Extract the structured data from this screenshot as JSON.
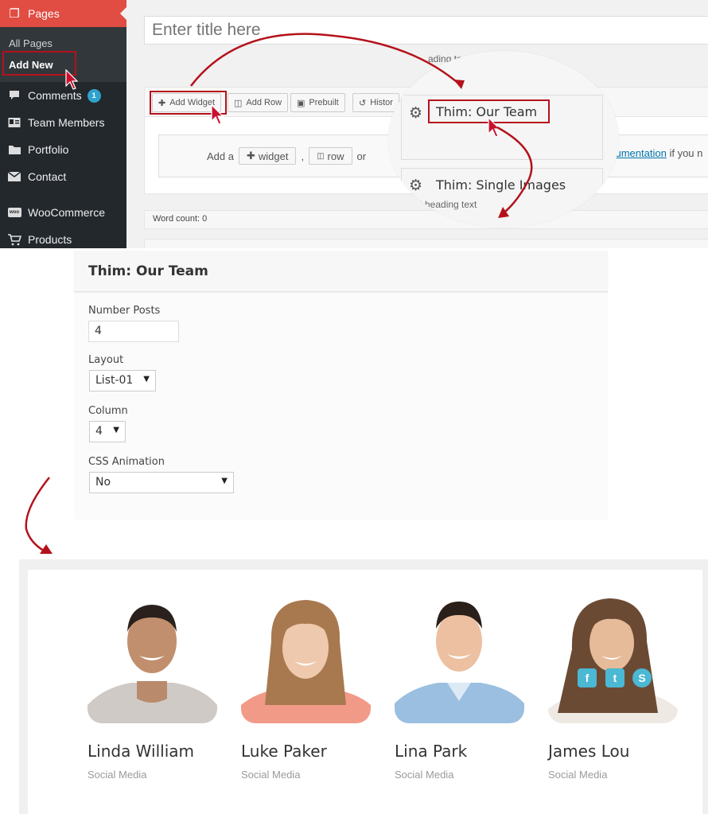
{
  "admin_menu": {
    "pages": "Pages",
    "all_pages": "All Pages",
    "add_new": "Add New",
    "comments": "Comments",
    "comments_count": "1",
    "team_members": "Team Members",
    "portfolio": "Portfolio",
    "contact": "Contact",
    "woocommerce": "WooCommerce",
    "woo_icon_text": "woo",
    "products": "Products"
  },
  "editor": {
    "title_placeholder": "Enter title here",
    "heading_text_fragment": "ading text",
    "toolbar": {
      "add_widget": "Add Widget",
      "add_row": "Add Row",
      "prebuilt": "Prebuilt",
      "history": "Histor"
    },
    "empty_state": {
      "prefix": "Add a",
      "widget": "widget",
      "comma": ",",
      "row": "row",
      "or": "or",
      "doc_link": "cumentation",
      "suffix": "if you n"
    },
    "word_count": "Word count: 0"
  },
  "zoom": {
    "widget_1": "Thim: Our Team",
    "widget_2": "Thim: Single Images",
    "heading_text_fragment": "d heading text"
  },
  "widget_form": {
    "title": "Thim: Our Team",
    "number_posts_label": "Number Posts",
    "number_posts_value": "4",
    "layout_label": "Layout",
    "layout_value": "List-01",
    "column_label": "Column",
    "column_value": "4",
    "css_animation_label": "CSS Animation",
    "css_animation_value": "No"
  },
  "team": [
    {
      "name": "Linda William",
      "role": "Social Media"
    },
    {
      "name": "Luke Paker",
      "role": "Social Media"
    },
    {
      "name": "Lina Park",
      "role": "Social Media"
    },
    {
      "name": "James Lou",
      "role": "Social Media"
    }
  ],
  "social_icons": [
    "facebook-icon",
    "twitter-icon",
    "skype-icon"
  ],
  "colors": {
    "accent_red": "#e14d43",
    "highlight_red": "#b4121b",
    "admin_bg": "#23282d",
    "social_blue": "#4bb8d4"
  }
}
